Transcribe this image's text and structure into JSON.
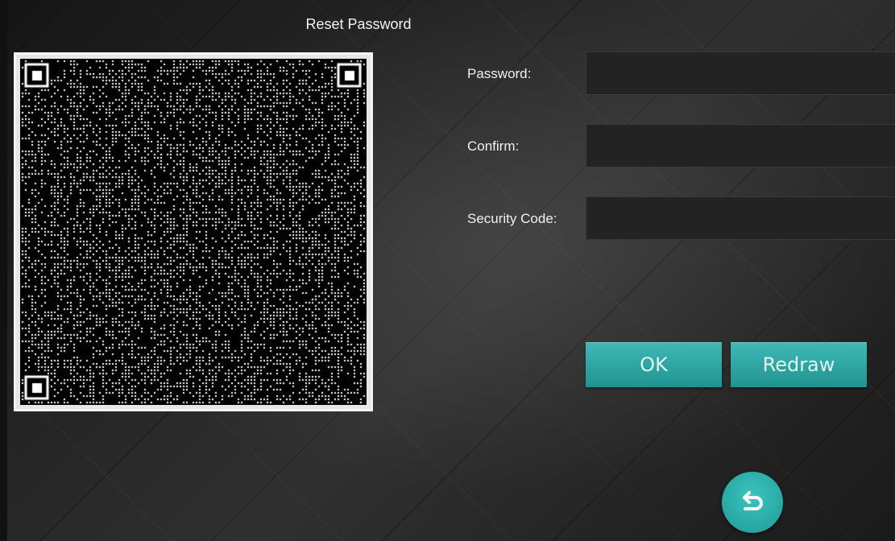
{
  "header": {
    "title": "Reset Password"
  },
  "form": {
    "password_label": "Password:",
    "password_value": "",
    "confirm_label": "Confirm:",
    "confirm_value": "",
    "security_code_label": "Security Code:",
    "security_code_value": ""
  },
  "actions": {
    "ok_label": "OK",
    "redraw_label": "Redraw"
  },
  "icons": {
    "back": "return-arrow-icon"
  },
  "colors": {
    "accent": "#26a6a2",
    "background": "#222222",
    "input_bg": "#232323"
  }
}
